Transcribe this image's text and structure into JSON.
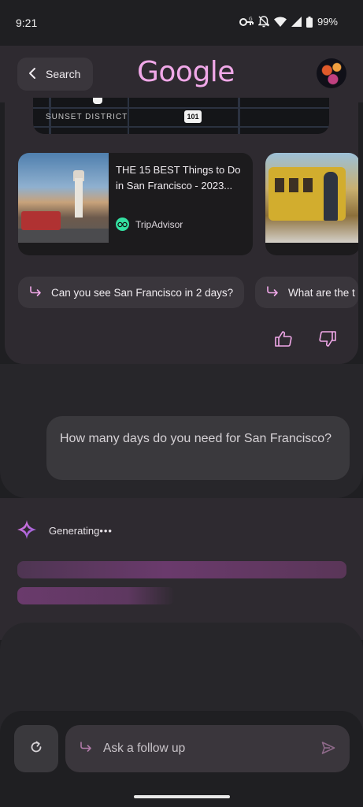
{
  "status_bar": {
    "time": "9:21",
    "battery": "99%",
    "icons": [
      "vpn-key-icon",
      "notifications-off-icon",
      "wifi-icon",
      "signal-icon",
      "battery-icon"
    ]
  },
  "header": {
    "search_label": "Search",
    "logo_text": "Google",
    "avatar_icon": "user-avatar"
  },
  "map": {
    "district_label": "SUNSET DISTRICT",
    "route_shield": "101"
  },
  "results": [
    {
      "title": "THE 15 BEST Things to Do in San Francisco - 2023...",
      "source": "TripAdvisor",
      "image": "ferry-building-photo"
    },
    {
      "title": "",
      "source": "",
      "image": "cable-car-photo"
    }
  ],
  "suggestions": [
    {
      "label": "Can you see San Francisco in 2 days?",
      "icon": "subdirectory-arrow-icon"
    },
    {
      "label": "What are the t",
      "icon": "subdirectory-arrow-icon"
    }
  ],
  "feedback": {
    "up_icon": "thumb-up-icon",
    "down_icon": "thumb-down-icon"
  },
  "query": {
    "text": "How many days do you need for San Francisco?"
  },
  "response": {
    "status": "Generating",
    "dots": "•••",
    "icon": "sparkle-icon"
  },
  "input": {
    "placeholder": "Ask a follow up",
    "reload_icon": "refresh-icon",
    "send_icon": "send-icon"
  },
  "colors": {
    "accent": "#f0a8e8",
    "surface": "#2e2a30",
    "background": "#1f1f22",
    "skeleton": "#6a3a6c",
    "tripadvisor": "#34e0a1"
  }
}
